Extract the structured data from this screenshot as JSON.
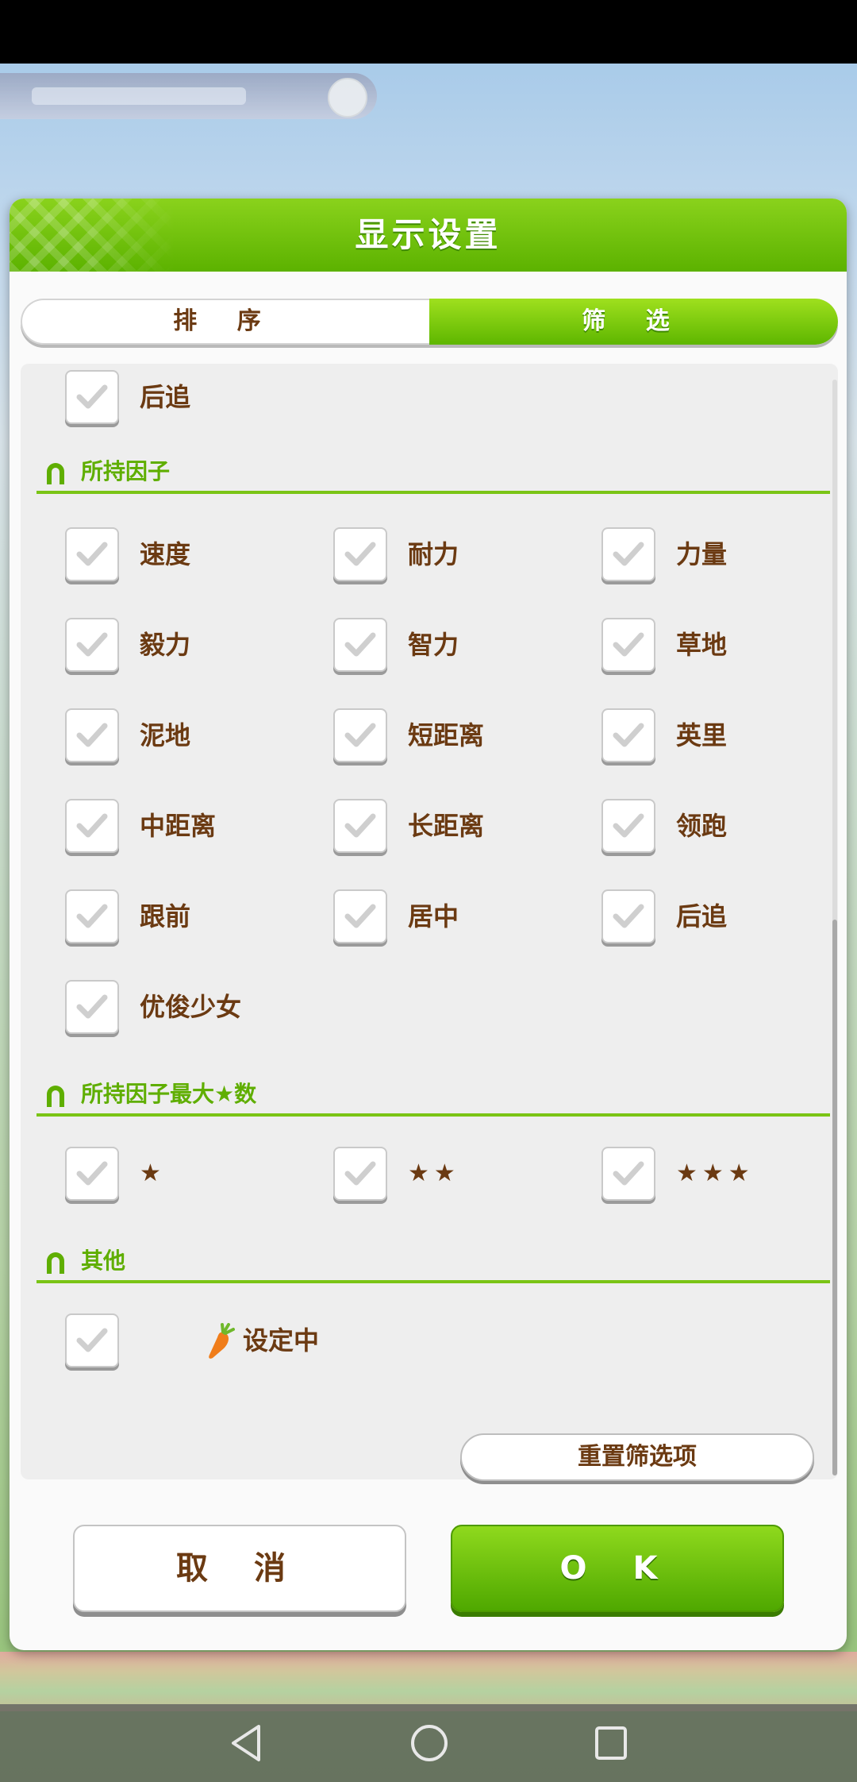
{
  "dialog": {
    "title": "显示设置",
    "tabs": {
      "sort": "排 序",
      "filter": "筛 选",
      "active": "filter"
    },
    "top_item": {
      "label": "后追",
      "checked": true
    },
    "sections": [
      {
        "title": "所持因子",
        "items": [
          {
            "label": "速度",
            "checked": true
          },
          {
            "label": "耐力",
            "checked": true
          },
          {
            "label": "力量",
            "checked": true
          },
          {
            "label": "毅力",
            "checked": true
          },
          {
            "label": "智力",
            "checked": true
          },
          {
            "label": "草地",
            "checked": true
          },
          {
            "label": "泥地",
            "checked": true
          },
          {
            "label": "短距离",
            "checked": true
          },
          {
            "label": "英里",
            "checked": true
          },
          {
            "label": "中距离",
            "checked": true
          },
          {
            "label": "长距离",
            "checked": true
          },
          {
            "label": "领跑",
            "checked": true
          },
          {
            "label": "跟前",
            "checked": true
          },
          {
            "label": "居中",
            "checked": true
          },
          {
            "label": "后追",
            "checked": true
          },
          {
            "label": "优俊少女",
            "checked": true
          }
        ]
      },
      {
        "title": "所持因子最大★数",
        "items": [
          {
            "label": "★",
            "checked": true
          },
          {
            "label": "★★",
            "checked": true
          },
          {
            "label": "★★★",
            "checked": true
          }
        ]
      },
      {
        "title": "其他",
        "items": [
          {
            "label": "设定中",
            "checked": true,
            "icon": "carrot-icon"
          }
        ]
      }
    ],
    "reset_button": "重置筛选项",
    "cancel_button": "取 消",
    "ok_button": "O K"
  },
  "colors": {
    "accent_green": "#6cc000",
    "label_brown": "#6b3a12"
  }
}
